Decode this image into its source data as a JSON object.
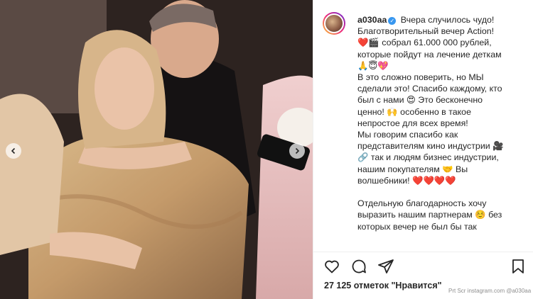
{
  "post": {
    "username": "a030aa",
    "caption": " Вчера случилось чудо!\nБлаготворительный вечер Action!\n❤️🎬 собрал 61.000 000 рублей,\nкоторые пойдут на лечение деткам\n🙏😇💖\nВ это сложно поверить, но МЫ\nсделали это! Спасибо каждому, кто\nбыл с нами 😍 Это бесконечно\nценно! 🙌 особенно в такое\nнепростое для всех время!\nМы говорим спасибо как\nпредставителям кино индустрии 🎥\n🔗 так и людям бизнес индустрии,\nнашим покупателям 🤝 Вы\nволшебники! ❤️❤️❤️❤️\n\nОтдельную благодарность хочу\nвыразить нашим партнерам ☺️ без\nкоторых вечер не был бы так",
    "likes": "27 125 отметок \"Нравится\"",
    "watermark": "Prt Scr instagram.com @a030aa"
  },
  "icons": {
    "like": "heart-icon",
    "comment": "comment-icon",
    "share": "share-icon",
    "save": "bookmark-icon",
    "verified": "verified-badge-icon",
    "prev": "chevron-left-icon",
    "next": "chevron-right-icon"
  },
  "colors": {
    "verified": "#3897f0",
    "text": "#262626",
    "muted": "#8e8e8e"
  }
}
